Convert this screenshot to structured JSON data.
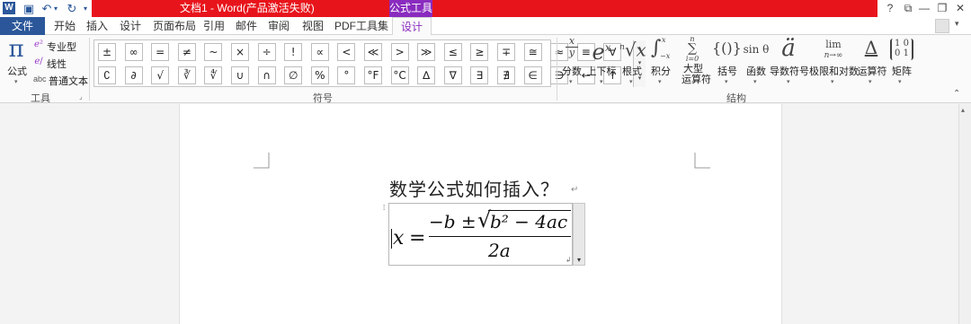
{
  "window": {
    "title": "文档1 - Word(产品激活失败)",
    "context_tab_label": "公式工具",
    "controls": [
      "?",
      "⧉",
      "—",
      "❐",
      "✕"
    ],
    "colors": {
      "titlebar": "#e8141b",
      "context": "#8a2bbf",
      "file": "#2b579a"
    }
  },
  "tabs": [
    "文件",
    "开始",
    "插入",
    "设计",
    "页面布局",
    "引用",
    "邮件",
    "审阅",
    "视图",
    "PDF工具集",
    "设计"
  ],
  "tools_group": {
    "label": "工具",
    "formula_label": "公式",
    "options": [
      "专业型",
      "线性",
      "普通文本"
    ],
    "abc": "abc"
  },
  "symbols_group": {
    "label": "符号",
    "row1": [
      "±",
      "∞",
      "=",
      "≠",
      "~",
      "×",
      "÷",
      "!",
      "∝",
      "<",
      "≪",
      ">",
      "≫",
      "≤",
      "≥",
      "∓",
      "≅",
      "≈",
      "≡",
      "∀"
    ],
    "row2": [
      "∁",
      "∂",
      "√",
      "∛",
      "∜",
      "∪",
      "∩",
      "∅",
      "%",
      "°",
      "°F",
      "°C",
      "∆",
      "∇",
      "∃",
      "∄",
      "∈",
      "∋",
      "←",
      "↑"
    ]
  },
  "structures_group": {
    "label": "结构",
    "items": [
      {
        "label": "分数",
        "icon": "fraction-icon"
      },
      {
        "label": "上下标",
        "icon": "script-icon"
      },
      {
        "label": "根式",
        "icon": "radical-icon"
      },
      {
        "label": "积分",
        "icon": "integral-icon"
      },
      {
        "label": "大型\n运算符",
        "icon": "large-operator-icon"
      },
      {
        "label": "括号",
        "icon": "bracket-icon"
      },
      {
        "label": "函数",
        "icon": "function-icon"
      },
      {
        "label": "导数符号",
        "icon": "accent-icon"
      },
      {
        "label": "极限和对数",
        "icon": "limit-icon"
      },
      {
        "label": "运算符",
        "icon": "operator-icon"
      },
      {
        "label": "矩阵",
        "icon": "matrix-icon"
      }
    ],
    "icon_text": {
      "fraction_num": "x",
      "fraction_den": "y",
      "script": "e",
      "script_sup": "x",
      "radical_idx": "n",
      "radical_body": "√x",
      "integral": "∫",
      "integral_sup": "x",
      "integral_sub": "−x",
      "bigop_top": "n",
      "bigop": "∑",
      "bigop_bottom": "i=0",
      "bracket": "{()}",
      "func": "sin θ",
      "accent": "ä",
      "limit_top": "lim",
      "limit_bottom": "n→∞",
      "operator": "Δ",
      "matrix_r1": "1 0",
      "matrix_r2": "0 1"
    }
  },
  "document": {
    "heading": "数学公式如何插入？",
    "formula": {
      "lhs": "x",
      "eq": "=",
      "numerator_prefix": "−b ±",
      "radicand": "b² − 4ac",
      "denominator": "2a"
    }
  }
}
